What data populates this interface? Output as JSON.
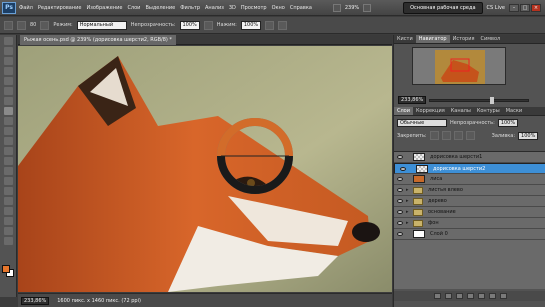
{
  "menubar": {
    "logo": "Ps",
    "items": [
      "Файл",
      "Редактирование",
      "Изображение",
      "Слои",
      "Выделение",
      "Фильтр",
      "Анализ",
      "3D",
      "Просмотр",
      "Окно",
      "Справка"
    ],
    "zoom": "239%",
    "workspace": "Основная рабочая среда",
    "cs_live": "CS Live"
  },
  "options": {
    "brush_size": "80",
    "mode_label": "Режим:",
    "mode_value": "Нормальный",
    "opacity_label": "Непрозрачность:",
    "opacity_value": "100%",
    "pressure_label": "Нажим:",
    "pressure_value": "100%"
  },
  "document": {
    "tab_title": "Рыжая осень.psd @ 239% (дорисовка шерсти2, RGB/8) *"
  },
  "status": {
    "zoom": "233,86%",
    "doc_info": "1600 пикс. x 1460 пикс. (72 ppi)"
  },
  "panels": {
    "top_tabs": [
      "Кисти",
      "Навигатор",
      "История",
      "Символ"
    ],
    "active_top_tab": "Навигатор",
    "nav_zoom": "233,86%",
    "layer_tabs": [
      "Слои",
      "Коррекция",
      "Каналы",
      "Контуры",
      "Маски"
    ],
    "blend_mode": "Обычные",
    "opacity_label": "Непрозрачность:",
    "opacity_value": "100%",
    "lock_label": "Закрепить:",
    "fill_label": "Заливка:",
    "fill_value": "100%",
    "layers": [
      {
        "name": "дорисовка шерсти1",
        "type": "layer",
        "selected": false
      },
      {
        "name": "дорисовка шерсти2",
        "type": "layer",
        "selected": true
      },
      {
        "name": "лиса",
        "type": "layer",
        "selected": false
      },
      {
        "name": "листья влево",
        "type": "group",
        "selected": false
      },
      {
        "name": "дерево",
        "type": "group",
        "selected": false
      },
      {
        "name": "основание",
        "type": "group",
        "selected": false
      },
      {
        "name": "фон",
        "type": "group",
        "selected": false
      },
      {
        "name": "Слой 0",
        "type": "layer",
        "selected": false
      }
    ]
  },
  "colors": {
    "foreground": "#e6762c",
    "background": "#ffffff",
    "selection": "#3d8fd6"
  }
}
